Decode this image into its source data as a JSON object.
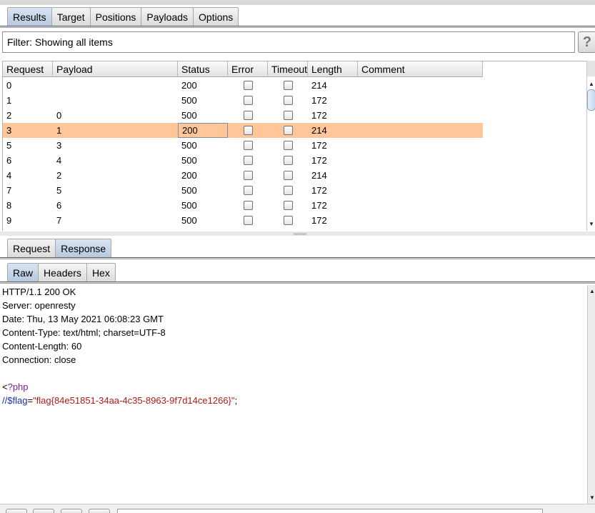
{
  "main_tabs": [
    {
      "label": "Results",
      "active": true
    },
    {
      "label": "Target",
      "active": false
    },
    {
      "label": "Positions",
      "active": false
    },
    {
      "label": "Payloads",
      "active": false
    },
    {
      "label": "Options",
      "active": false
    }
  ],
  "filter": {
    "text": "Filter: Showing all items",
    "help_label": "?"
  },
  "table": {
    "columns": [
      "Request",
      "Payload",
      "Status",
      "Error",
      "Timeout",
      "Length",
      "Comment"
    ],
    "rows": [
      {
        "request": "0",
        "payload": "",
        "status": "200",
        "error": false,
        "timeout": false,
        "length": "214",
        "comment": "",
        "selected": false
      },
      {
        "request": "1",
        "payload": "",
        "status": "500",
        "error": false,
        "timeout": false,
        "length": "172",
        "comment": "",
        "selected": false
      },
      {
        "request": "2",
        "payload": "0",
        "status": "500",
        "error": false,
        "timeout": false,
        "length": "172",
        "comment": "",
        "selected": false
      },
      {
        "request": "3",
        "payload": "1",
        "status": "200",
        "error": false,
        "timeout": false,
        "length": "214",
        "comment": "",
        "selected": true
      },
      {
        "request": "5",
        "payload": "3",
        "status": "500",
        "error": false,
        "timeout": false,
        "length": "172",
        "comment": "",
        "selected": false
      },
      {
        "request": "6",
        "payload": "4",
        "status": "500",
        "error": false,
        "timeout": false,
        "length": "172",
        "comment": "",
        "selected": false
      },
      {
        "request": "4",
        "payload": "2",
        "status": "200",
        "error": false,
        "timeout": false,
        "length": "214",
        "comment": "",
        "selected": false
      },
      {
        "request": "7",
        "payload": "5",
        "status": "500",
        "error": false,
        "timeout": false,
        "length": "172",
        "comment": "",
        "selected": false
      },
      {
        "request": "8",
        "payload": "6",
        "status": "500",
        "error": false,
        "timeout": false,
        "length": "172",
        "comment": "",
        "selected": false
      },
      {
        "request": "9",
        "payload": "7",
        "status": "500",
        "error": false,
        "timeout": false,
        "length": "172",
        "comment": "",
        "selected": false
      }
    ]
  },
  "message_tabs": [
    {
      "label": "Request",
      "active": false
    },
    {
      "label": "Response",
      "active": true
    }
  ],
  "view_tabs": [
    {
      "label": "Raw",
      "active": true
    },
    {
      "label": "Headers",
      "active": false
    },
    {
      "label": "Hex",
      "active": false
    }
  ],
  "response": {
    "headers": [
      "HTTP/1.1 200 OK",
      "Server: openresty",
      "Date: Thu, 13 May 2021 06:08:23 GMT",
      "Content-Type: text/html; charset=UTF-8",
      "Content-Length: 60",
      "Connection: close"
    ],
    "code_open": {
      "lt": "<",
      "tag": "?php"
    },
    "code_line": {
      "comment": "//",
      "var": "$flag",
      "eq": "=",
      "str": "\"flag{84e51851-34aa-4c35-8963-9f7d14ce1266}\"",
      "end": ";"
    }
  },
  "colors": {
    "selected_row": "#ffc699",
    "active_tab": "#b6c9e0"
  }
}
